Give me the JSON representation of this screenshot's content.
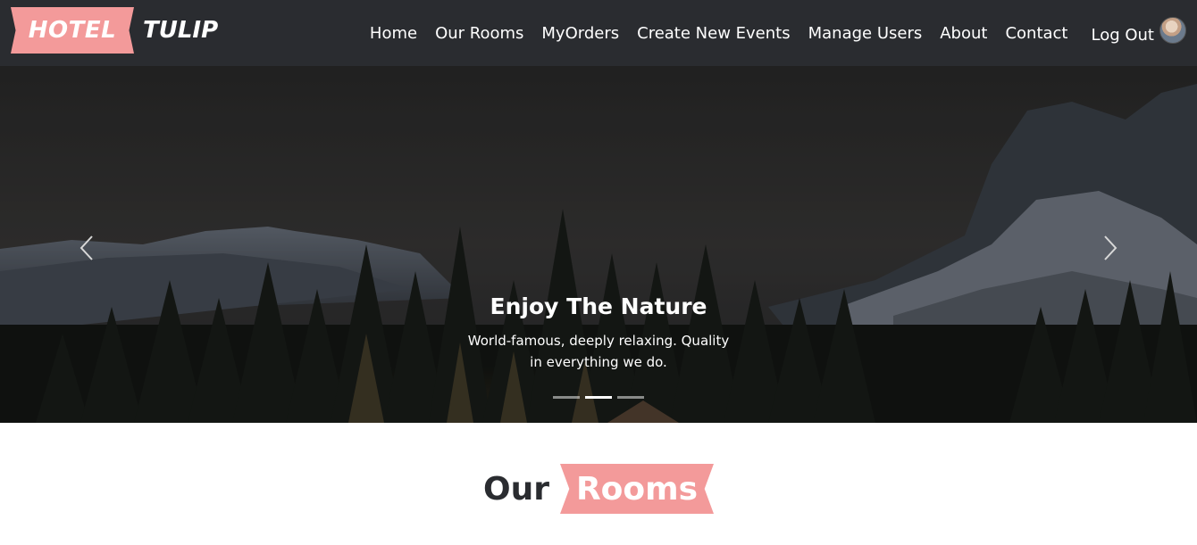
{
  "brand": {
    "first": "HOTEL",
    "second": "TULIP",
    "accent_color": "#f39a9a"
  },
  "nav": {
    "items": [
      {
        "label": "Home"
      },
      {
        "label": "Our Rooms"
      },
      {
        "label": "MyOrders"
      },
      {
        "label": "Create New Events"
      },
      {
        "label": "Manage Users"
      },
      {
        "label": "About"
      },
      {
        "label": "Contact"
      }
    ],
    "logout_label": "Log Out",
    "avatar_icon": "user-avatar",
    "background_color": "#2a2c30"
  },
  "carousel": {
    "caption_title": "Enjoy The Nature",
    "caption_text": "World-famous, deeply relaxing. Quality in everything we do.",
    "slide_count": 3,
    "active_index": 1,
    "prev_icon": "chevron-left-icon",
    "next_icon": "chevron-right-icon"
  },
  "section": {
    "heading_plain": "Our",
    "heading_highlight": "Rooms"
  }
}
